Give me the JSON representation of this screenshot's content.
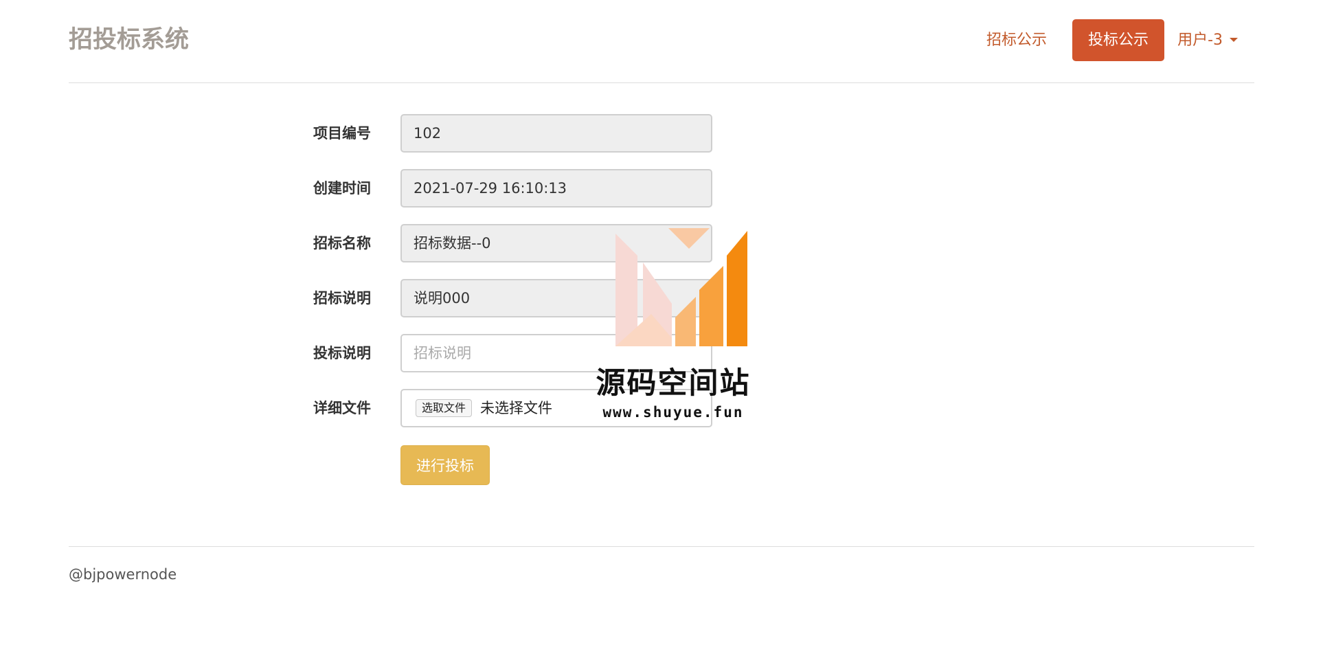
{
  "header": {
    "brand": "招投标系统",
    "nav": {
      "bid_notice": "招标公示",
      "tender_notice": "投标公示",
      "user_menu": "用户-3"
    }
  },
  "form": {
    "project_no": {
      "label": "项目编号",
      "value": "102"
    },
    "created_time": {
      "label": "创建时间",
      "value": "2021-07-29 16:10:13"
    },
    "bid_name": {
      "label": "招标名称",
      "value": "招标数据--0"
    },
    "bid_desc": {
      "label": "招标说明",
      "value": "说明000"
    },
    "tender_desc": {
      "label": "投标说明",
      "value": "",
      "placeholder": "招标说明"
    },
    "detail_file": {
      "label": "详细文件",
      "button_label": "选取文件",
      "status_text": "未选择文件"
    },
    "submit_label": "进行投标"
  },
  "footer": {
    "text": "@bjpowernode"
  },
  "watermark": {
    "title": "源码空间站",
    "url": "www.shuyue.fun"
  },
  "colors": {
    "brand_text": "#a39c95",
    "nav_link": "#c25a2b",
    "nav_active_bg": "#d1542c",
    "submit_bg": "#e7b954",
    "readonly_bg": "#eeeeee"
  }
}
